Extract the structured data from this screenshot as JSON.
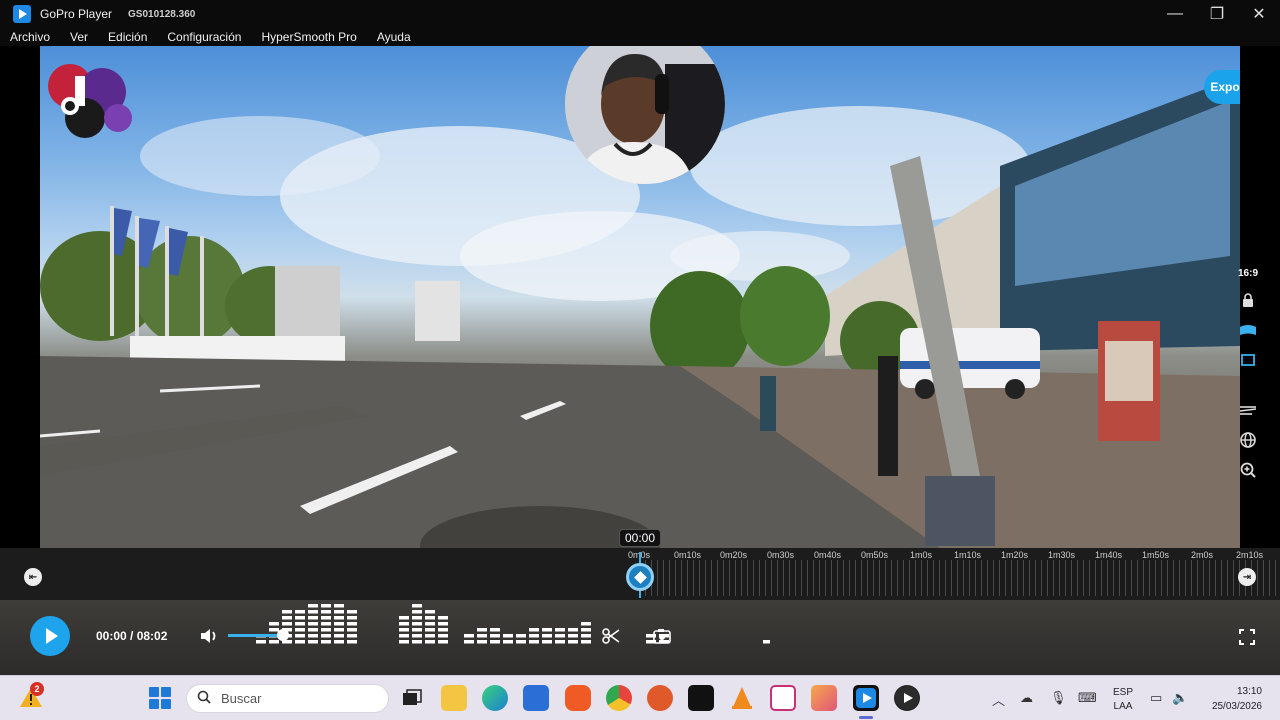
{
  "window": {
    "app_title": "GoPro Player",
    "file_name": "GS010128.360",
    "controls": {
      "minimize": "—",
      "maximize": "❐",
      "close": "✕"
    }
  },
  "menu": [
    "Archivo",
    "Ver",
    "Edición",
    "Configuración",
    "HyperSmooth Pro",
    "Ayuda"
  ],
  "video": {
    "export_label": "Exportar",
    "aspect_ratio": "16:9",
    "side_tools": [
      "lock-icon",
      "reframe-icon",
      "crop-icon",
      "horizon-icon",
      "globe-icon",
      "zoom-in-icon"
    ]
  },
  "timeline": {
    "tooltip": "00:00",
    "ticks": [
      "0m0s",
      "0m10s",
      "0m20s",
      "0m30s",
      "0m40s",
      "0m50s",
      "1m0s",
      "1m10s",
      "1m20s",
      "1m30s",
      "1m40s",
      "1m50s",
      "2m0s",
      "2m10s"
    ],
    "playhead_fraction": 0.0
  },
  "player": {
    "time_display": "00:00 / 08:02",
    "volume_fraction": 0.92,
    "icons": [
      "speaker-icon",
      "scissors-icon",
      "snapshot-icon",
      "fullscreen-icon"
    ]
  },
  "taskbar": {
    "notification_badge": "2",
    "search_placeholder": "Buscar",
    "apps": [
      "task-view-icon",
      "file-explorer-icon",
      "edge-icon",
      "store-icon",
      "brave-icon",
      "chrome-icon",
      "duckduckgo-icon",
      "capcut-icon",
      "vlc-icon",
      "snipping-tool-icon",
      "clipchamp-icon",
      "gopro-player-icon",
      "media-player-icon"
    ],
    "language_top": "ESP",
    "language_bottom": "LAA",
    "time": "13:10",
    "date": "25/03/2026"
  },
  "colors": {
    "accent": "#1ea4ec",
    "titlebar": "#0b0b0b",
    "controls_bg": "#2c2b29",
    "taskbar_bg": "#e6e3ef"
  }
}
